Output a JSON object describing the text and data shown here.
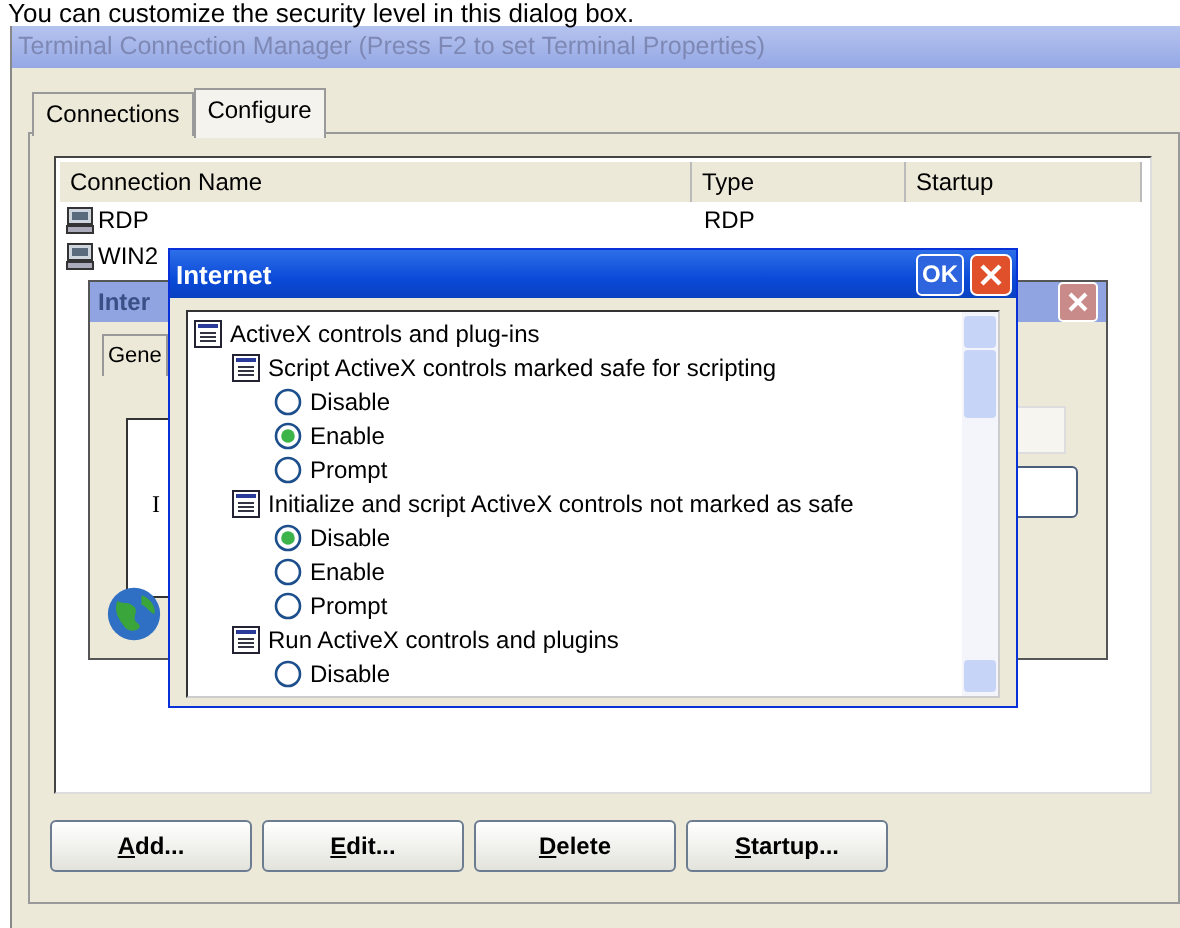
{
  "caption": "You can customize the security level in this dialog box.",
  "window": {
    "title": "Terminal Connection Manager (Press F2 to set Terminal Properties)"
  },
  "tabs": [
    {
      "label": "Connections",
      "selected": false
    },
    {
      "label": "Configure",
      "selected": true
    }
  ],
  "table": {
    "columns": [
      "Connection Name",
      "Type",
      "Startup"
    ],
    "rows": [
      {
        "name": "RDP",
        "type": "RDP"
      },
      {
        "name": "WIN2"
      }
    ]
  },
  "back_dialog": {
    "title": "Inter",
    "tab": "Gene",
    "label": "I"
  },
  "dialog": {
    "title": "Internet",
    "ok": "OK",
    "tree": {
      "label": "ActiveX controls and plug-ins",
      "children": [
        {
          "label": "Script ActiveX controls marked safe for scripting",
          "options": [
            {
              "label": "Disable",
              "selected": false
            },
            {
              "label": "Enable",
              "selected": true
            },
            {
              "label": "Prompt",
              "selected": false
            }
          ]
        },
        {
          "label": "Initialize and script ActiveX controls not marked as safe",
          "options": [
            {
              "label": "Disable",
              "selected": true
            },
            {
              "label": "Enable",
              "selected": false
            },
            {
              "label": "Prompt",
              "selected": false
            }
          ]
        },
        {
          "label": "Run ActiveX controls and plugins",
          "options": [
            {
              "label": "Disable",
              "selected": false
            }
          ]
        }
      ]
    }
  },
  "buttons": [
    "Add...",
    "Edit...",
    "Delete",
    "Startup..."
  ]
}
